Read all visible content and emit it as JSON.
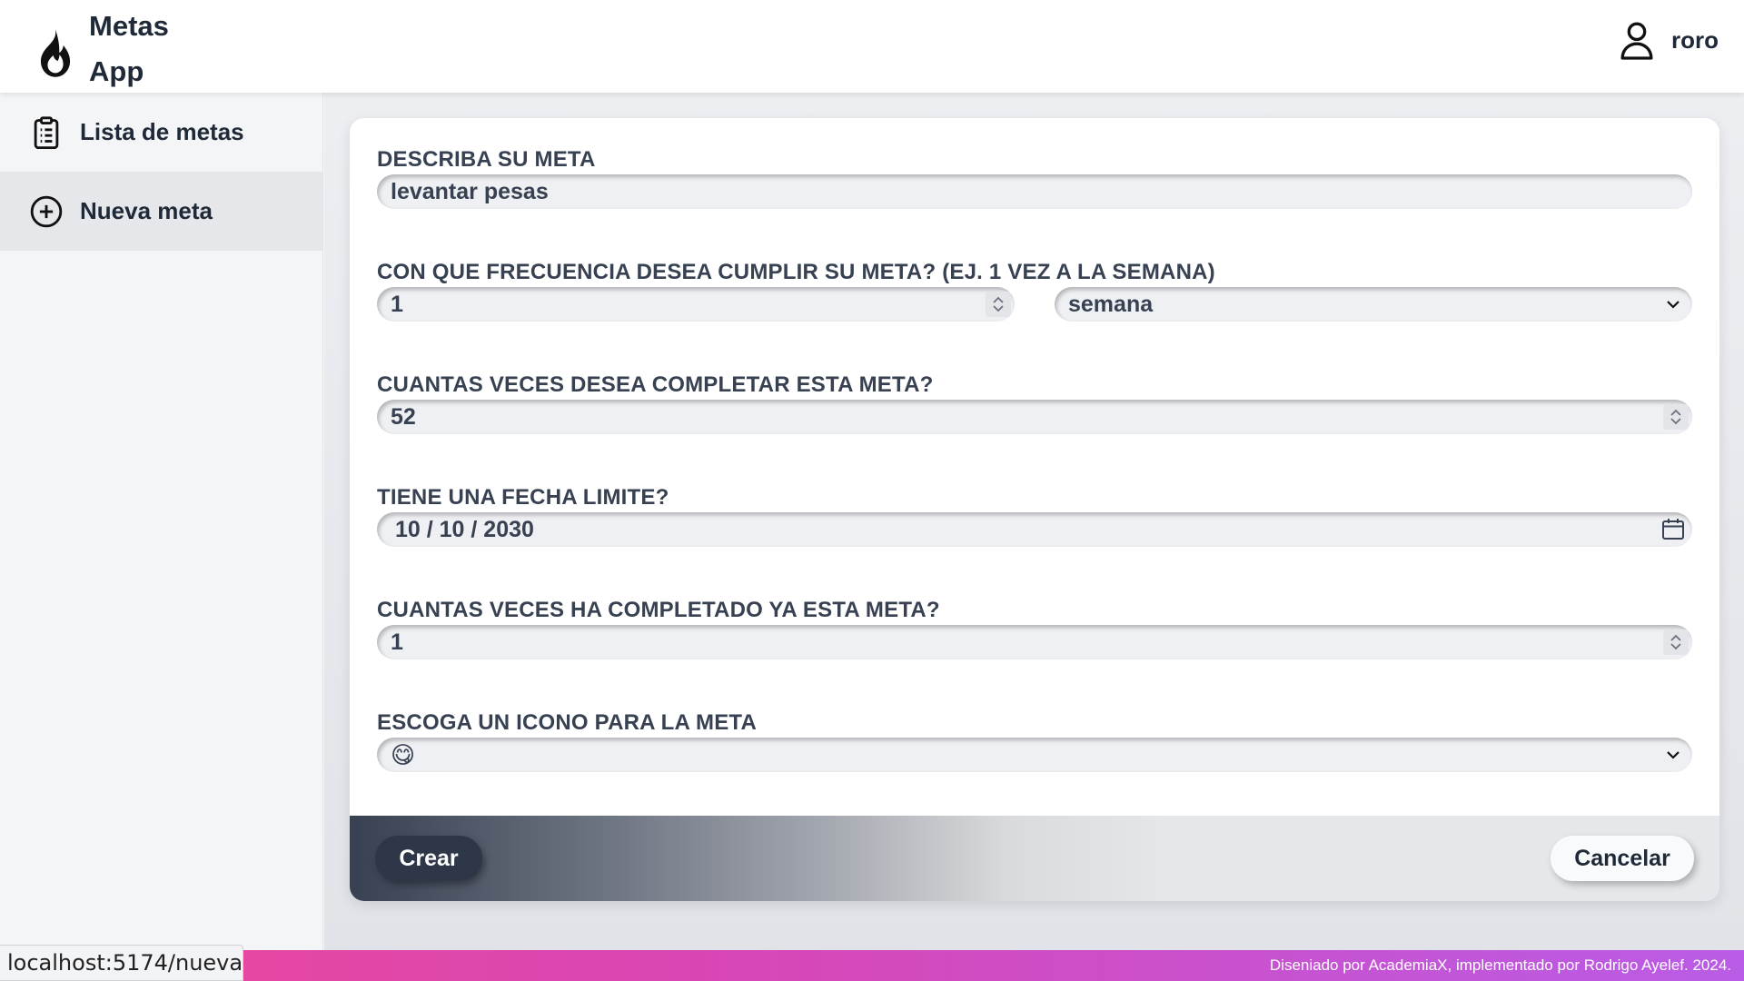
{
  "app": {
    "title_line1": "Metas",
    "title_line2": "App",
    "logo_icon": "flame-icon",
    "user_icon": "user-icon",
    "username": "roro"
  },
  "sidebar": {
    "items": [
      {
        "label": "Lista de metas",
        "icon": "clipboard-list-icon",
        "active": false
      },
      {
        "label": "Nueva meta",
        "icon": "plus-circle-icon",
        "active": true
      }
    ]
  },
  "form": {
    "description": {
      "label": "DESCRIBA SU META",
      "value": "levantar pesas"
    },
    "frequency": {
      "label": "CON QUE FRECUENCIA DESEA CUMPLIR SU META? (EJ. 1 VEZ A LA SEMANA)",
      "count_value": "1",
      "period_value": "semana"
    },
    "total": {
      "label": "CUANTAS VECES DESEA COMPLETAR ESTA META?",
      "value": "52"
    },
    "deadline": {
      "label": "TIENE UNA FECHA LIMITE?",
      "value": "10 / 10 / 2030"
    },
    "completed": {
      "label": "CUANTAS VECES HA COMPLETADO YA ESTA META?",
      "value": "1"
    },
    "icon": {
      "label": "ESCOGA UN ICONO PARA LA META",
      "value": "😋"
    }
  },
  "actions": {
    "create_label": "Crear",
    "cancel_label": "Cancelar"
  },
  "footer": {
    "credit": "Diseniado por AcademiaX, implementado por Rodrigo Ayelef. 2024."
  },
  "status_url": "localhost:5174/nueva",
  "colors": {
    "footer_gradient_start": "#ec4899",
    "footer_gradient_end": "#b95ce6",
    "create_button": "#2d3748"
  }
}
